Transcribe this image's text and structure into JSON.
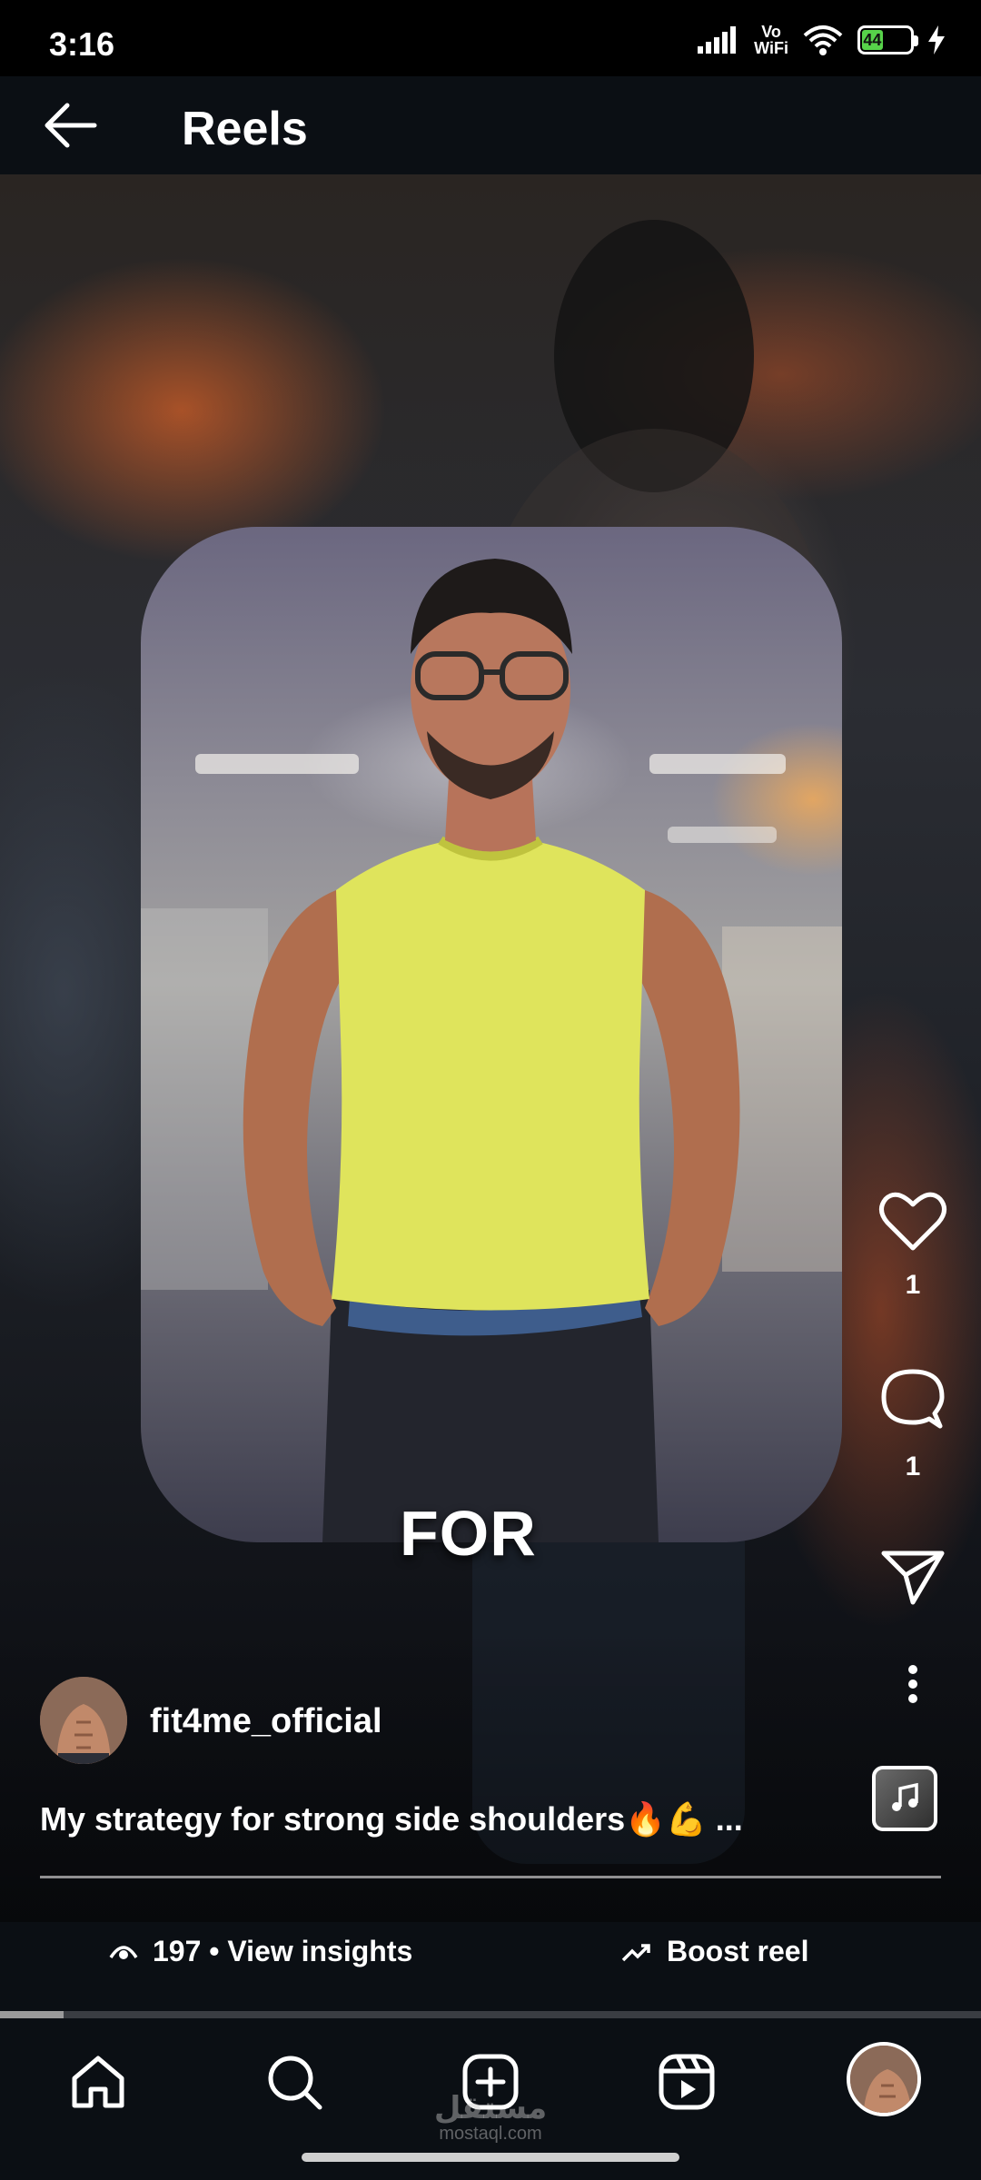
{
  "status_bar": {
    "time": "3:16",
    "vowifi_top": "Vo",
    "vowifi_bottom": "WiFi",
    "battery": "44"
  },
  "header": {
    "back_icon": "arrow-left-icon",
    "title": "Reels"
  },
  "reel": {
    "overlay_text": "FOR",
    "author": "fit4me_official",
    "caption": "My strategy for strong side shoulders🔥💪 ...",
    "like_count": "1",
    "comment_count": "1",
    "progress_fraction": 0.065
  },
  "actions": {
    "like_icon": "heart-icon",
    "comment_icon": "comment-icon",
    "share_icon": "send-icon",
    "more_icon": "more-vertical-icon",
    "music_icon": "music-note-icon"
  },
  "insights": {
    "views": "197 • View insights",
    "boost": "Boost reel"
  },
  "nav": {
    "items": [
      "home-icon",
      "search-icon",
      "create-icon",
      "reels-icon",
      "profile-avatar"
    ],
    "watermark_top": "مستقل",
    "watermark_bottom": "mostaql.com"
  },
  "colors": {
    "bar_background": "#0b0f14",
    "battery_green": "#57d24a",
    "shirt_yellow": "#dfe45c"
  }
}
